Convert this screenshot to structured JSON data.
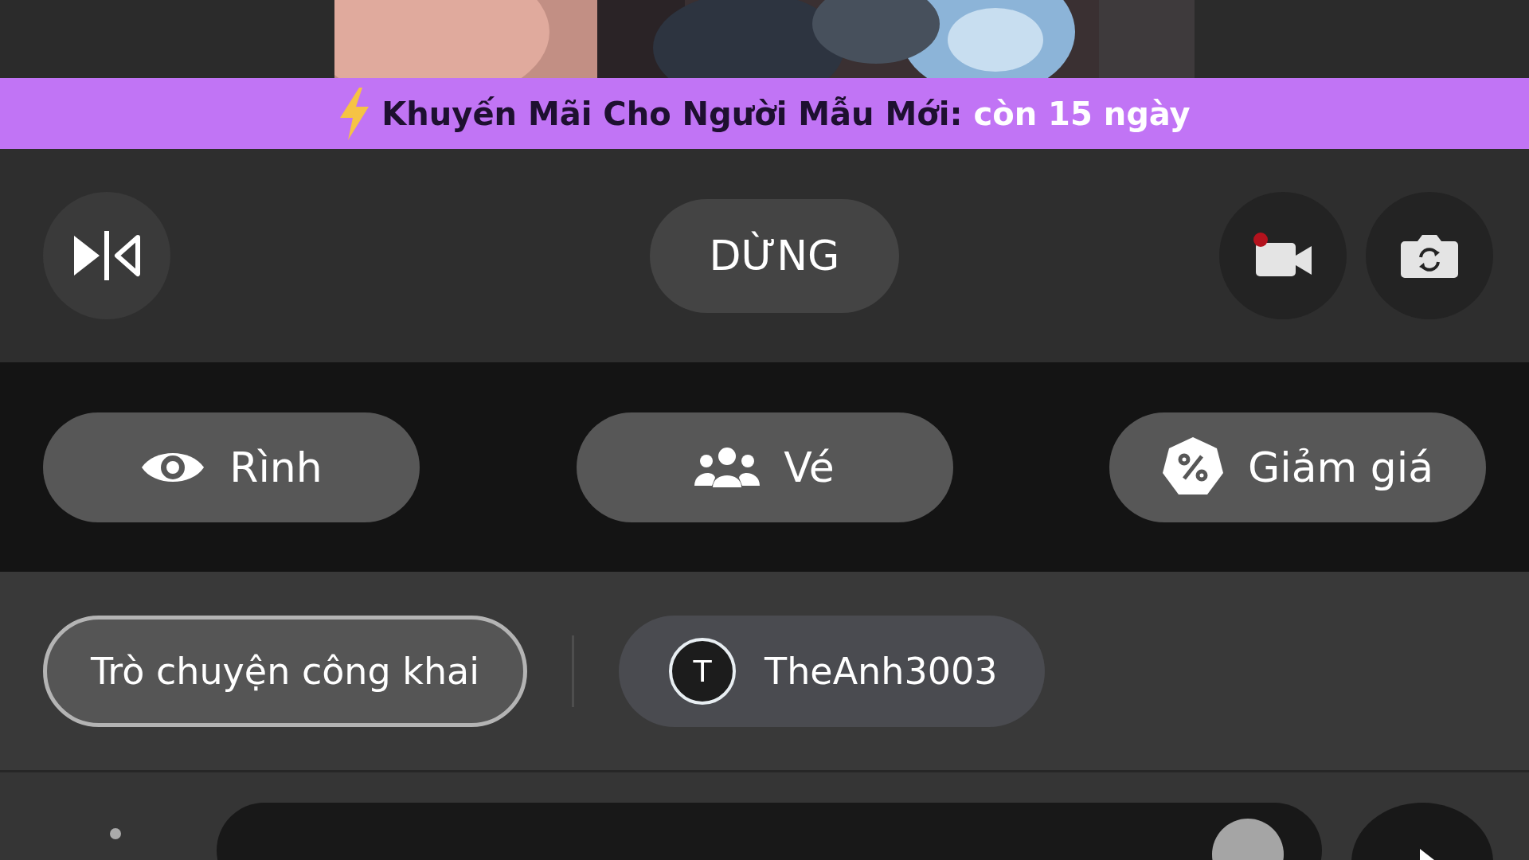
{
  "promo": {
    "label": "Khuyến Mãi Cho Người Mẫu Mới:",
    "countdown": "còn 15 ngày"
  },
  "controls": {
    "stop_button": "DỪNG",
    "recording": true
  },
  "actions": [
    {
      "kind": "spy",
      "label": "Rình"
    },
    {
      "kind": "ticket",
      "label": "Vé"
    },
    {
      "kind": "discount",
      "label": "Giảm giá"
    }
  ],
  "chat_tabs": [
    {
      "label": "Trò chuyện công khai",
      "selected": true
    },
    {
      "label": "TheAnh3003",
      "avatar": "T",
      "selected": false
    }
  ]
}
